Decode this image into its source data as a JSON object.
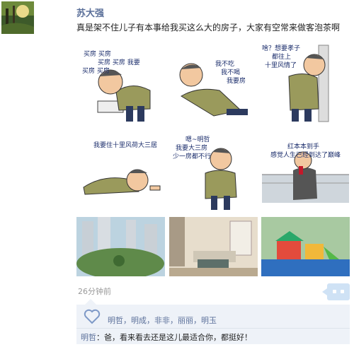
{
  "post": {
    "author": "苏大强",
    "text": "真是架不住儿子有本事给我买这么大的房子，大家有空常来做客泡茶啊",
    "time": "26分钟前",
    "stickers": [
      {
        "caption_lines": [
          "买房 买房",
          "买房 买房 我要",
          "买房 买房"
        ]
      },
      {
        "caption_lines": [
          "我不吃",
          "我不喝",
          "我要房"
        ]
      },
      {
        "caption_lines": [
          "啥？想要孝子",
          "都往上",
          "十里风情了"
        ]
      },
      {
        "caption_lines": [
          "我要住十里风荷大三居"
        ]
      },
      {
        "caption_lines": [
          "嗯~明哲",
          "我要大三房",
          "少一房都不行"
        ]
      },
      {
        "caption_lines": [
          "红本本到手",
          "感觉人生已经到达了巅峰"
        ]
      }
    ],
    "photos": [
      "housing-estate-garden",
      "living-room-interior",
      "children-playground"
    ]
  },
  "likes": {
    "names": [
      "明哲",
      "明成",
      "非非",
      "丽丽",
      "明玉"
    ],
    "separator": "，"
  },
  "comment": {
    "commenter": "明哲",
    "sep": "：",
    "text": "爸，看来看去还是这儿最适合你，都挺好！"
  },
  "colors": {
    "name_blue": "#5a6f99",
    "bubble_bg": "#cfe2f5",
    "panel_bg": "#eef2f8",
    "caption": "#1a2c6b",
    "vest": "#9a9a5c"
  }
}
